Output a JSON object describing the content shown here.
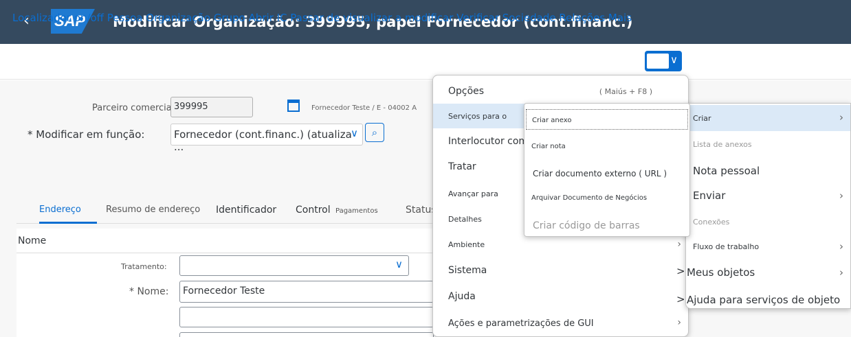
{
  "header": {
    "back_glyph": "‹",
    "logo": "SAP",
    "title": "Modificar Organização: 399995, papel Fornecedor (cont.financ.)"
  },
  "toolbar": {
    "items_text": "Localizador on/off Pessoa Organização Grupo Abrir IC Passar de visualizar a modificar Verificar Sociedade Relações Mais",
    "toggle_chevron": "∨"
  },
  "form": {
    "partner_label": "Parceiro comercial:",
    "partner_value": "399995",
    "partner_desc": "Fornecedor Teste / E - 04002 A",
    "role_label": "* Modificar em função:",
    "role_value": "Fornecedor (cont.financ.) (atualiza ...",
    "tabs": [
      "Endereço",
      "Resumo de endereço",
      "Identificador",
      "Control",
      "Pagamentos",
      "Status"
    ],
    "section_title": "Nome",
    "salutation_label": "Tratamento:",
    "name_label": "* Nome:",
    "name_value": "Fornecedor Teste"
  },
  "menu_main": {
    "items": [
      {
        "label": "Opções",
        "shortcut": "( Maiús + F8 )"
      },
      {
        "label": "Serviços para o"
      },
      {
        "label": "Interlocutor com"
      },
      {
        "label": "Tratar"
      },
      {
        "label": "Avançar para"
      },
      {
        "label": "Detalhes"
      },
      {
        "label": "Ambiente",
        "arrow": "›"
      },
      {
        "label": "Sistema",
        "arrow": ">"
      },
      {
        "label": "Ajuda",
        "arrow": ">"
      },
      {
        "label": "Ações e parametrizações de GUI",
        "arrow": "›"
      }
    ]
  },
  "menu_services": {
    "items": [
      "Criar anexo",
      "Criar nota",
      "Criar documento externo ( URL )",
      "Arquivar Documento de Negócios",
      "Criar código de barras"
    ]
  },
  "menu_right": {
    "items": [
      {
        "label": "Criar",
        "arrow": "›"
      },
      {
        "label": "Lista de anexos"
      },
      {
        "label": "Nota pessoal"
      },
      {
        "label": "Enviar",
        "arrow": "›"
      },
      {
        "label": "Conexões"
      },
      {
        "label": "Fluxo de trabalho",
        "arrow": "›"
      },
      {
        "label": "Meus objetos",
        "arrow": "›"
      },
      {
        "label": "Ajuda para serviços de objeto"
      }
    ]
  },
  "colors": {
    "shell": "#354a5f",
    "accent": "#0a6ed1",
    "highlight": "#dbe9f7"
  }
}
